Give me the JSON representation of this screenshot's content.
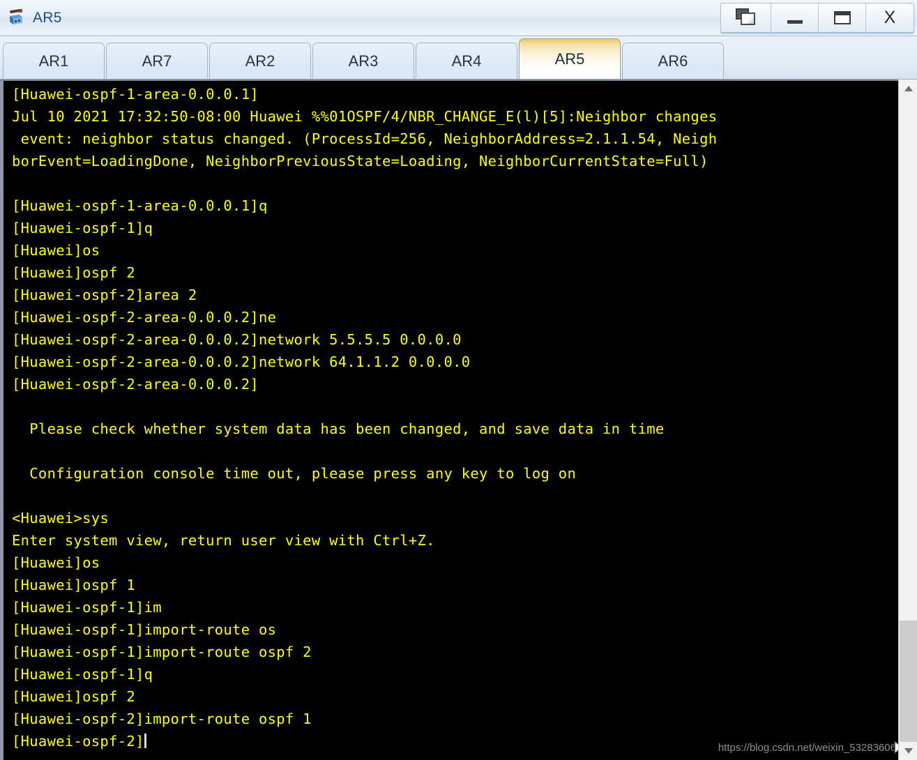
{
  "window": {
    "title": "AR5",
    "icon": "router-icon",
    "buttons": [
      {
        "name": "cascade-windows-button",
        "label": ""
      },
      {
        "name": "minimize-button",
        "label": ""
      },
      {
        "name": "maximize-button",
        "label": ""
      },
      {
        "name": "close-button",
        "label": "X"
      }
    ]
  },
  "tabs": [
    {
      "label": "AR1",
      "active": false
    },
    {
      "label": "AR7",
      "active": false
    },
    {
      "label": "AR2",
      "active": false
    },
    {
      "label": "AR3",
      "active": false
    },
    {
      "label": "AR4",
      "active": false
    },
    {
      "label": "AR5",
      "active": true
    },
    {
      "label": "AR6",
      "active": false
    }
  ],
  "terminal": {
    "foreground": "#ffff00",
    "background": "#000000",
    "lines": [
      "[Huawei-ospf-1-area-0.0.0.1]",
      "Jul 10 2021 17:32:50-08:00 Huawei %%01OSPF/4/NBR_CHANGE_E(l)[5]:Neighbor changes",
      " event: neighbor status changed. (ProcessId=256, NeighborAddress=2.1.1.54, Neigh",
      "borEvent=LoadingDone, NeighborPreviousState=Loading, NeighborCurrentState=Full)",
      "",
      "[Huawei-ospf-1-area-0.0.0.1]q",
      "[Huawei-ospf-1]q",
      "[Huawei]os",
      "[Huawei]ospf 2",
      "[Huawei-ospf-2]area 2",
      "[Huawei-ospf-2-area-0.0.0.2]ne",
      "[Huawei-ospf-2-area-0.0.0.2]network 5.5.5.5 0.0.0.0",
      "[Huawei-ospf-2-area-0.0.0.2]network 64.1.1.2 0.0.0.0",
      "[Huawei-ospf-2-area-0.0.0.2]",
      "",
      "  Please check whether system data has been changed, and save data in time",
      "",
      "  Configuration console time out, please press any key to log on",
      "",
      "<Huawei>sys",
      "Enter system view, return user view with Ctrl+Z.",
      "[Huawei]os",
      "[Huawei]ospf 1",
      "[Huawei-ospf-1]im",
      "[Huawei-ospf-1]import-route os",
      "[Huawei-ospf-1]import-route ospf 2",
      "[Huawei-ospf-1]q",
      "[Huawei]ospf 2",
      "[Huawei-ospf-2]import-route ospf 1"
    ],
    "prompt_line": "[Huawei-ospf-2]"
  },
  "watermark": "https://blog.csdn.net/weixin_53283606",
  "scrollbar": {
    "up_arrow": "scroll-up-arrow",
    "down_arrow": "scroll-down-arrow"
  }
}
